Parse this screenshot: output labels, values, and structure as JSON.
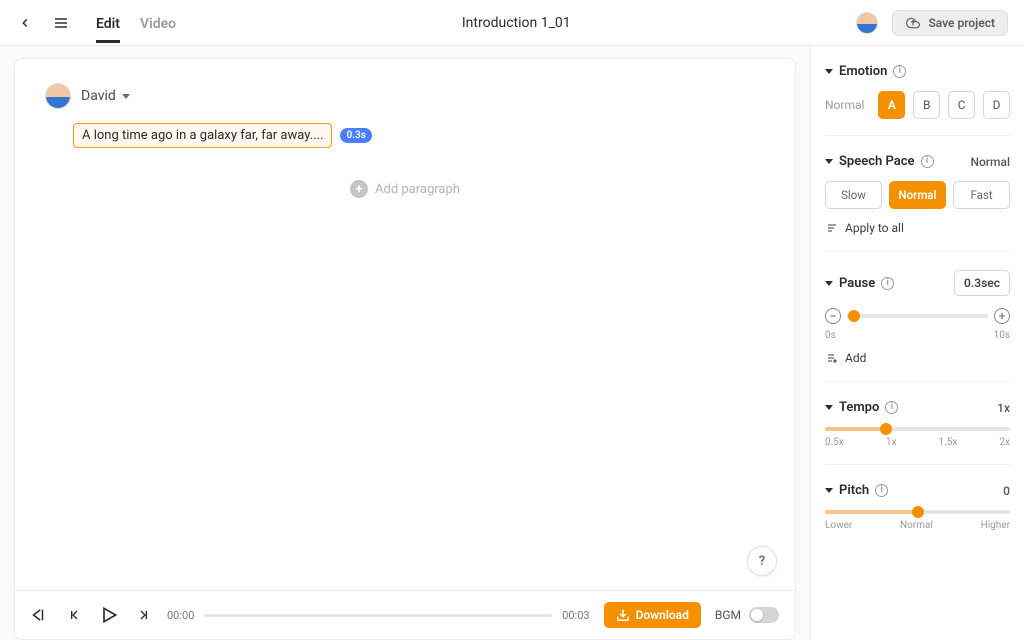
{
  "topbar": {
    "tabs": [
      {
        "label": "Edit",
        "active": true
      },
      {
        "label": "Video",
        "active": false
      }
    ],
    "title": "Introduction 1_01",
    "save_label": "Save project"
  },
  "editor": {
    "voice_name": "David",
    "text": "A long time ago in a galaxy far, far away....",
    "pause_badge": "0.3s",
    "add_paragraph_label": "Add paragraph",
    "help_label": "?"
  },
  "playbar": {
    "time_start": "00:00",
    "time_end": "00:03",
    "download_label": "Download",
    "bgm_label": "BGM"
  },
  "side": {
    "emotion": {
      "title": "Emotion",
      "normal_label": "Normal",
      "options": [
        "A",
        "B",
        "C",
        "D"
      ],
      "active": "A"
    },
    "pace": {
      "title": "Speech Pace",
      "value": "Normal",
      "options": [
        "Slow",
        "Normal",
        "Fast"
      ],
      "active": "Normal",
      "apply_all": "Apply to all"
    },
    "pause": {
      "title": "Pause",
      "value": "0.3sec",
      "min_label": "0s",
      "max_label": "10s",
      "percent": 5,
      "add_label": "Add"
    },
    "tempo": {
      "title": "Tempo",
      "value": "1x",
      "labels": [
        "0.5x",
        "1x",
        "1.5x",
        "2x"
      ],
      "percent": 33
    },
    "pitch": {
      "title": "Pitch",
      "value": "0",
      "labels": [
        "Lower",
        "Normal",
        "Higher"
      ],
      "percent": 50
    }
  }
}
